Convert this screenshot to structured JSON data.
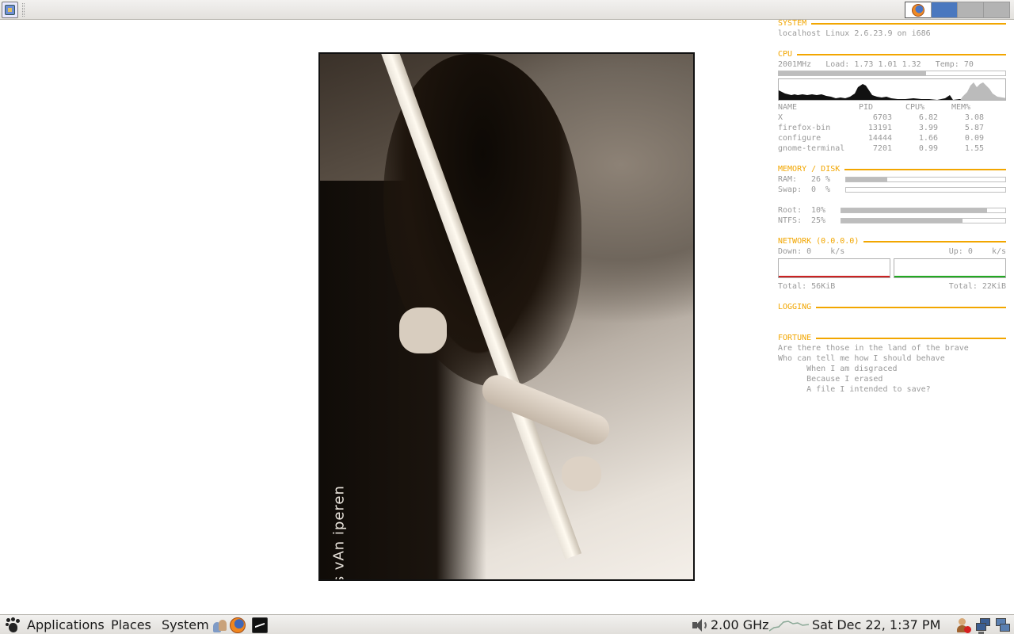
{
  "top_panel": {
    "workspaces": [
      "workspace 1",
      "workspace 2",
      "workspace 3",
      "workspace 4"
    ],
    "active_workspace": 2
  },
  "photo": {
    "credit": "© niels vAn iperen"
  },
  "conky": {
    "system": {
      "header": "SYSTEM",
      "host_line": "localhost Linux 2.6.23.9 on i686"
    },
    "cpu": {
      "header": "CPU",
      "freq": "2001MHz",
      "load_label": "Load:",
      "load": "1.73 1.01 1.32",
      "temp_label": "Temp:",
      "temp": "70",
      "usage_fraction": 0.65,
      "columns": [
        "NAME",
        "PID",
        "CPU%",
        "MEM%"
      ],
      "processes": [
        {
          "name": "X",
          "pid": "6703",
          "cpu": "6.82",
          "mem": "3.08"
        },
        {
          "name": "firefox-bin",
          "pid": "13191",
          "cpu": "3.99",
          "mem": "5.87"
        },
        {
          "name": "configure",
          "pid": "14444",
          "cpu": "1.66",
          "mem": "0.09"
        },
        {
          "name": "gnome-terminal",
          "pid": "7201",
          "cpu": "0.99",
          "mem": "1.55"
        }
      ]
    },
    "memory": {
      "header": "MEMORY / DISK",
      "ram_label": "RAM:",
      "ram": "26 %",
      "ram_fraction": 0.26,
      "swap_label": "Swap:",
      "swap": "0  %",
      "swap_fraction": 0.0,
      "root_label": "Root:",
      "root": "10%",
      "root_fraction": 0.89,
      "ntfs_label": "NTFS:",
      "ntfs": "25%",
      "ntfs_fraction": 0.74
    },
    "network": {
      "header": "NETWORK (0.0.0.0)",
      "down_label": "Down:",
      "down": "0",
      "down_unit": "k/s",
      "up_label": "Up:",
      "up": "0",
      "up_unit": "k/s",
      "total_down_label": "Total:",
      "total_down": "56KiB",
      "total_up_label": "Total:",
      "total_up": "22KiB",
      "down_color": "#cc2222",
      "up_color": "#22aa22"
    },
    "logging": {
      "header": "LOGGING"
    },
    "fortune": {
      "header": "FORTUNE",
      "lines": [
        "Are there those in the land of the brave",
        "Who can tell me how I should behave",
        "      When I am disgraced",
        "      Because I erased",
        "      A file I intended to save?"
      ]
    },
    "accent_color": "#f2a600",
    "text_color": "#999999"
  },
  "bottom_panel": {
    "menus": [
      "Applications",
      "Places",
      "System"
    ],
    "cpu_freq": "2.00 GHz",
    "clock": "Sat Dec 22,  1:37 PM"
  }
}
